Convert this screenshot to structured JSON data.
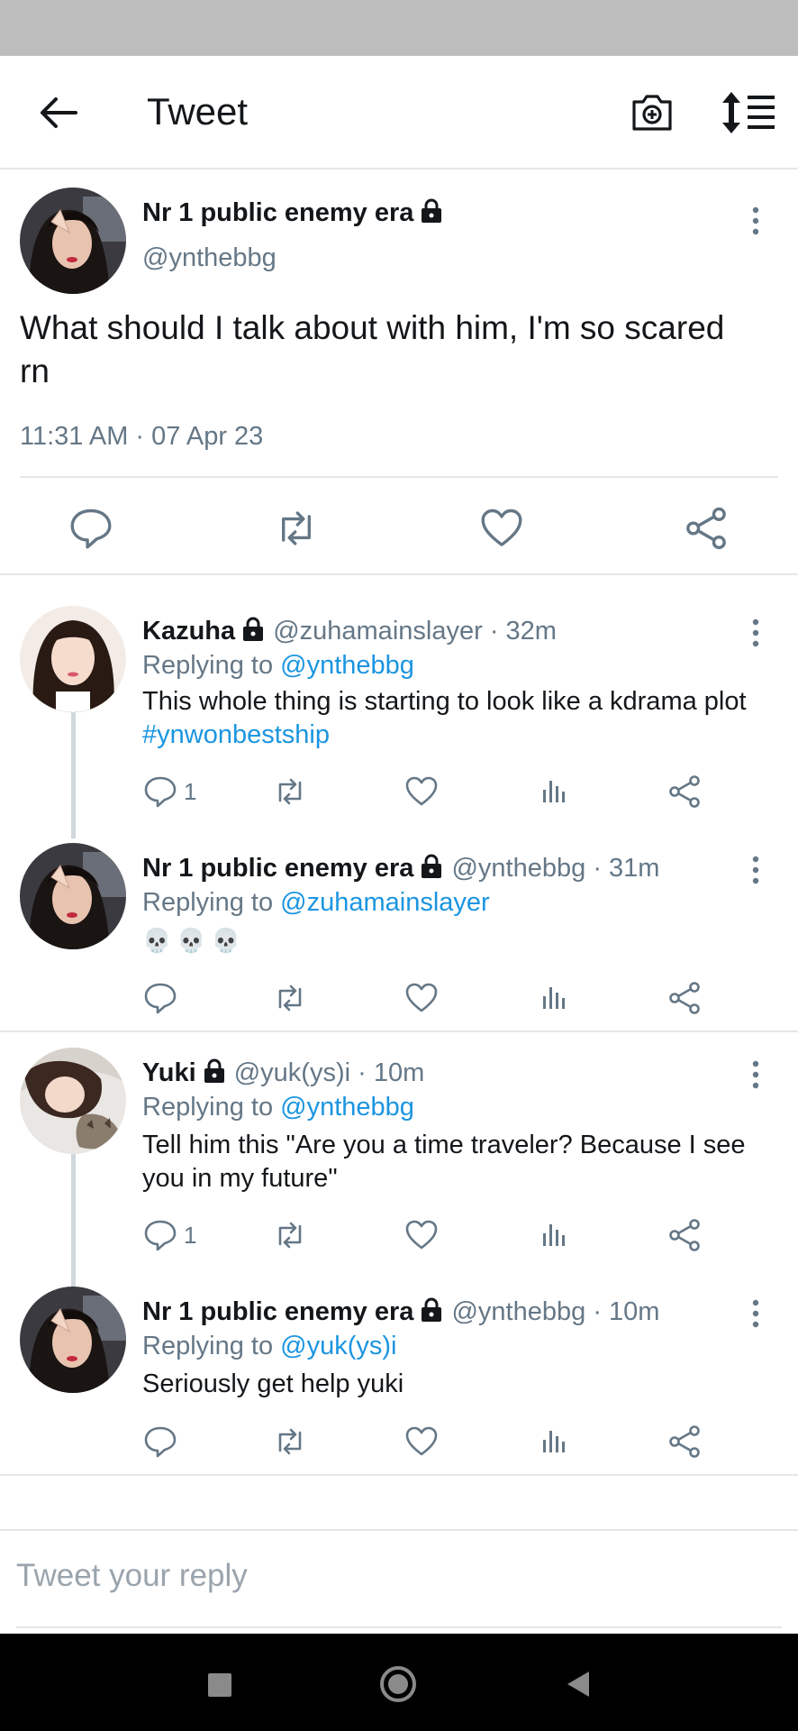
{
  "header": {
    "title": "Tweet"
  },
  "main_tweet": {
    "name": "Nr 1 public enemy era",
    "handle": "@ynthebbg",
    "text": "What should I talk about with him, I'm so scared rn",
    "timestamp": "11:31 AM · 07 Apr 23"
  },
  "replies": [
    {
      "name": "Kazuha",
      "handle": "@zuhamainslayer",
      "time": "· 32m",
      "replying_prefix": "Replying to",
      "replying_to": "@ynthebbg",
      "text": "This whole thing is starting to look like a kdrama plot",
      "hashtag": "#ynwonbestship",
      "reply_count": "1"
    },
    {
      "name": "Nr 1 public enemy era",
      "handle": "@ynthebbg",
      "time": "· 31m",
      "replying_prefix": "Replying to",
      "replying_to": "@zuhamainslayer",
      "text": "💀💀💀"
    },
    {
      "name": "Yuki",
      "handle": "@yuk(ys)i",
      "time": "· 10m",
      "replying_prefix": "Replying to",
      "replying_to": "@ynthebbg",
      "text": "Tell him this \"Are you a time traveler? Because I see you in my future\"",
      "reply_count": "1"
    },
    {
      "name": "Nr 1 public enemy era",
      "handle": "@ynthebbg",
      "time": "· 10m",
      "replying_prefix": "Replying to",
      "replying_to": "@yuk(ys)i",
      "text": "Seriously get help yuki"
    }
  ],
  "compose": {
    "placeholder": "Tweet your reply"
  },
  "icons": {
    "back": "arrow-left-icon",
    "camera": "camera-plus-icon",
    "sort": "sort-icon",
    "reply": "reply-bubble-icon",
    "retweet": "retweet-icon",
    "like": "heart-icon",
    "analytics": "analytics-icon",
    "share": "share-icon",
    "lock": "lock-icon",
    "more": "more-vertical-icon"
  },
  "colors": {
    "link": "#1b95e0",
    "secondary_text": "#657786",
    "thread_line": "#cfd9de"
  }
}
